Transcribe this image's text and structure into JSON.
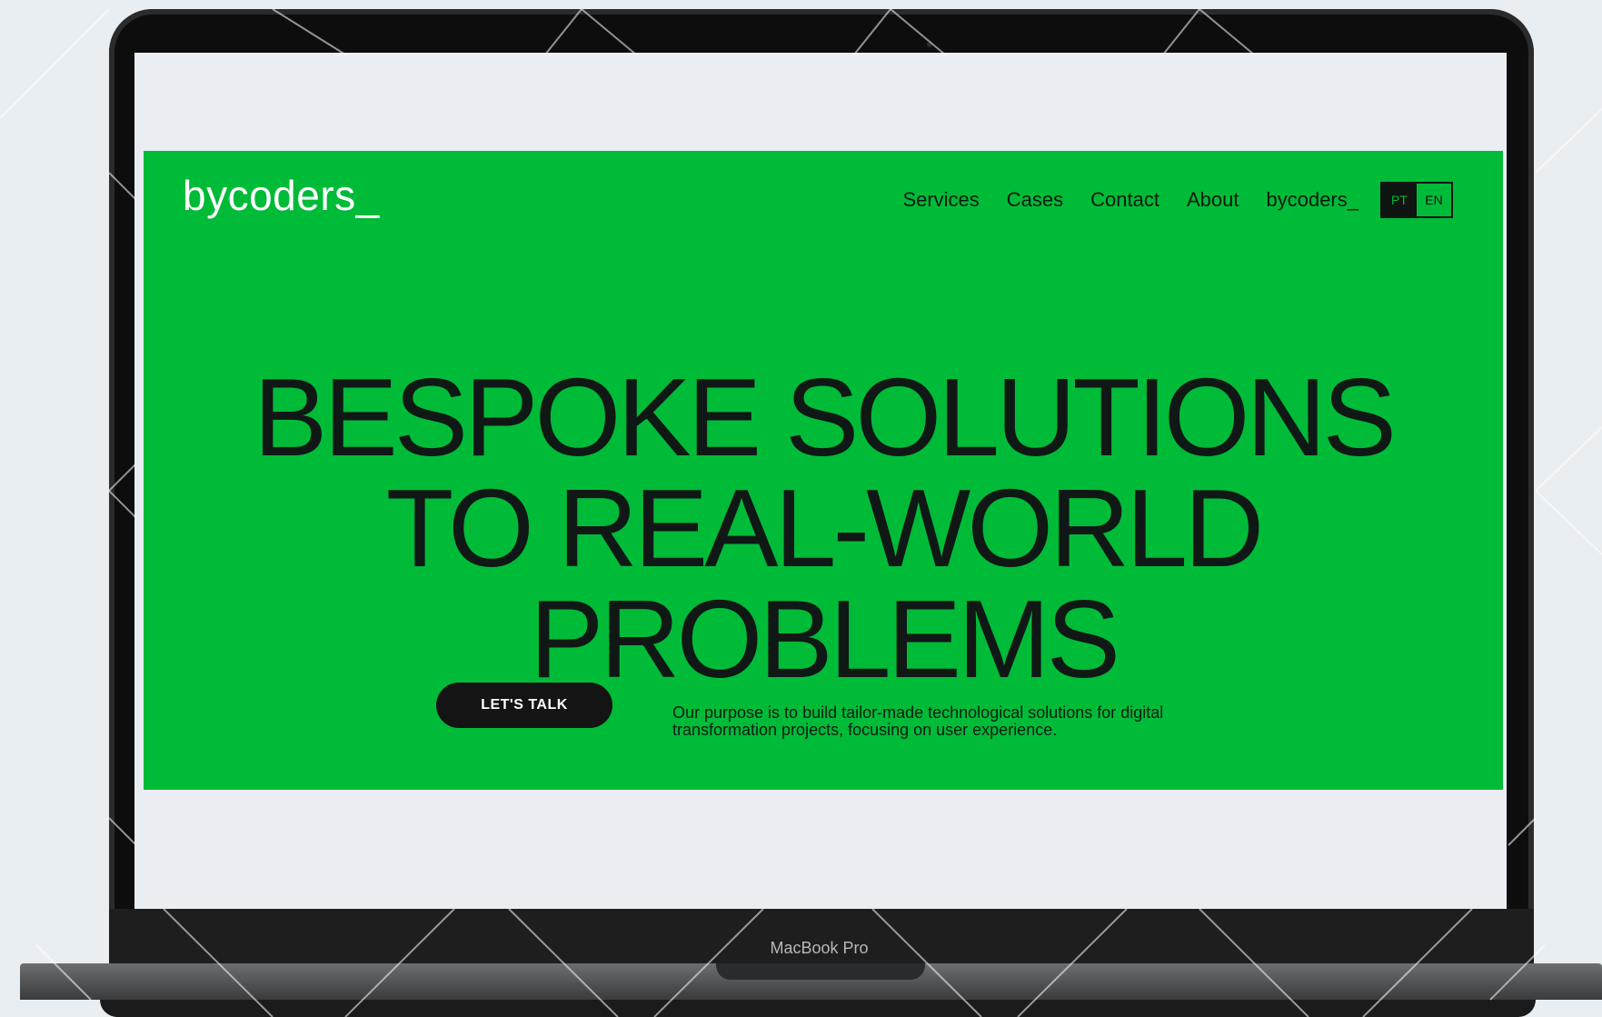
{
  "device": {
    "model_label": "MacBook Pro"
  },
  "site": {
    "logo": "bycoders_",
    "nav": {
      "items": [
        "Services",
        "Cases",
        "Contact",
        "About",
        "bycoders_"
      ],
      "lang_options": [
        "PT",
        "EN"
      ],
      "lang_selected": "PT"
    },
    "hero": {
      "headline_lines": [
        "BESPOKE SOLUTIONS",
        "TO REAL-WORLD",
        "PROBLEMS"
      ],
      "cta_label": "LET'S TALK",
      "purpose_text": "Our purpose is to build tailor-made technological solutions for digital transformation projects, focusing on user experience."
    }
  },
  "colors": {
    "brand_green": "#00bb38",
    "dark": "#141414",
    "page_bg": "#e9eef2"
  }
}
